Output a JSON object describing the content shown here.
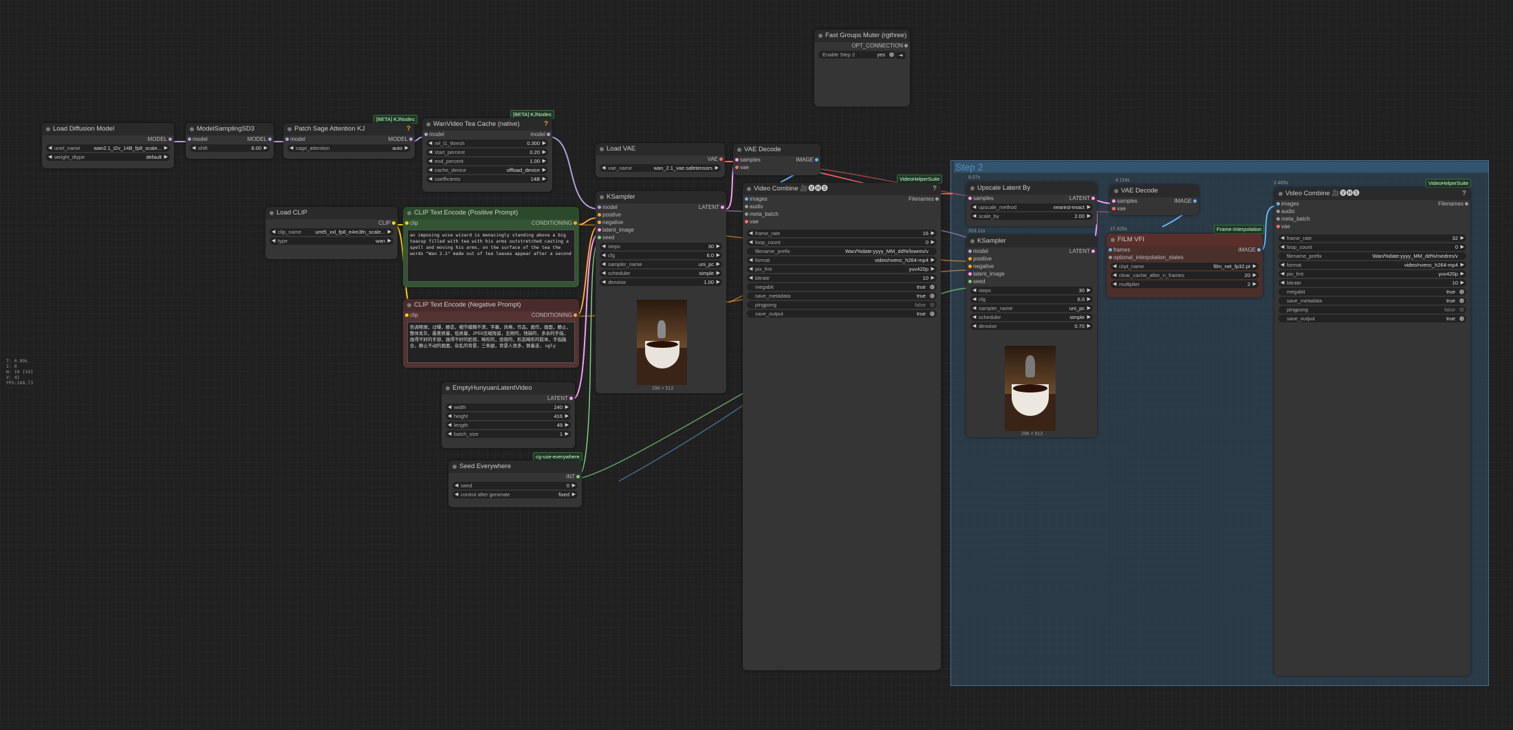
{
  "stats": [
    "T: 0.89s",
    "I: 0",
    "N: 19 [19]",
    "V: 41",
    "FPS:168.73"
  ],
  "group": {
    "title": "Step 2"
  },
  "badges": {
    "kj1": "[BETA] KJNodes",
    "kj2": "[BETA] KJNodes",
    "vhs1": "VideoHelperSuite",
    "vhs2": "VideoHelperSuite",
    "cg": "cg-use-everywhere",
    "fi": "Frame-Interpolation"
  },
  "timings": {
    "t1": "8.07s",
    "t2": "203.11s",
    "t3": "4.114s",
    "t4": "27.425s",
    "t5": "2.469s"
  },
  "load_diffusion": {
    "title": "Load Diffusion Model",
    "out": "MODEL",
    "w": [
      {
        "n": "unet_name",
        "v": "wan2.1_t2v_14B_fp8_scale..."
      },
      {
        "n": "weight_dtype",
        "v": "default"
      }
    ]
  },
  "model_sampling": {
    "title": "ModelSamplingSD3",
    "in": "model",
    "out": "MODEL",
    "w": [
      {
        "n": "shift",
        "v": "8.00"
      }
    ]
  },
  "patch_sage": {
    "title": "Patch Sage Attention KJ",
    "in": "model",
    "out": "MODEL",
    "w": [
      {
        "n": "sage_attention",
        "v": "auto"
      }
    ]
  },
  "teacache": {
    "title": "WanVideo Tea Cache (native)",
    "in": "model",
    "out": "model",
    "w": [
      {
        "n": "rel_l1_thresh",
        "v": "0.300"
      },
      {
        "n": "start_percent",
        "v": "0.20"
      },
      {
        "n": "end_percent",
        "v": "1.00"
      },
      {
        "n": "cache_device",
        "v": "offload_device"
      },
      {
        "n": "coefficients",
        "v": "14B"
      }
    ]
  },
  "load_vae": {
    "title": "Load VAE",
    "out": "VAE",
    "w": [
      {
        "n": "vae_name",
        "v": "wan_2.1_vae.safetensors"
      }
    ]
  },
  "vae_decode1": {
    "title": "VAE Decode",
    "in1": "samples",
    "in2": "vae",
    "out": "IMAGE"
  },
  "fast_groups": {
    "title": "Fast Groups Muter (rgthree)",
    "out": "OPT_CONNECTION",
    "toggle_label": "Enable Step 2",
    "toggle_value": "yes"
  },
  "load_clip": {
    "title": "Load CLIP",
    "out": "CLIP",
    "w": [
      {
        "n": "clip_name",
        "v": "umt5_xxl_fp8_e4m3fn_scale..."
      },
      {
        "n": "type",
        "v": "wan"
      }
    ]
  },
  "clip_pos": {
    "title": "CLIP Text Encode (Positive Prompt)",
    "in": "clip",
    "out": "CONDITIONING",
    "text": "an imposing wise wizard is menacingly standing above a big teacup filled with tea with his arms outstretched casting a spell and moving his arms, on the surface of the tea the words \"Wan 2.1\" made out of tea leaves appear after a second"
  },
  "clip_neg": {
    "title": "CLIP Text Encode (Negative Prompt)",
    "in": "clip",
    "out": "CONDITIONING",
    "text": "色调艳丽，过曝，静态，细节模糊不清，字幕，风格，作品，画作，画面，静止，整体发灰，最差质量，低质量，JPEG压缩残留，丑陋的，残缺的，多余的手指，画得不好的手部，画得不好的脸部，畸形的，毁容的，形态畸形的肢体，手指融合，静止不动的画面，杂乱的背景，三条腿，背景人很多，倒着走, ugly"
  },
  "ksampler1": {
    "title": "KSampler",
    "out": "LATENT",
    "ins": [
      "model",
      "positive",
      "negative",
      "latent_image",
      "seed"
    ],
    "w": [
      {
        "n": "steps",
        "v": "30"
      },
      {
        "n": "cfg",
        "v": "6.0"
      },
      {
        "n": "sampler_name",
        "v": "uni_pc"
      },
      {
        "n": "scheduler",
        "v": "simple"
      },
      {
        "n": "denoise",
        "v": "1.00"
      }
    ],
    "img_size": "296 × 512"
  },
  "empty_latent": {
    "title": "EmptyHunyuanLatentVideo",
    "out": "LATENT",
    "w": [
      {
        "n": "width",
        "v": "240"
      },
      {
        "n": "height",
        "v": "416"
      },
      {
        "n": "length",
        "v": "49"
      },
      {
        "n": "batch_size",
        "v": "1"
      }
    ]
  },
  "seed_ev": {
    "title": "Seed Everywhere",
    "out": "INT",
    "w": [
      {
        "n": "seed",
        "v": "0"
      },
      {
        "n": "control after generate",
        "v": "fixed"
      }
    ]
  },
  "video_combine1": {
    "title": "Video Combine 🎥🅥🅗🅢",
    "out": "Filenames",
    "ins": [
      "images",
      "audio",
      "meta_batch",
      "vae"
    ],
    "w": [
      {
        "n": "frame_rate",
        "v": "16"
      },
      {
        "n": "loop_count",
        "v": "0"
      },
      {
        "n": "filename_prefix",
        "v": "Wan/%date:yyyy_MM_dd%/lowres/v"
      },
      {
        "n": "format",
        "v": "video/nvenc_h264-mp4"
      },
      {
        "n": "pix_fmt",
        "v": "yuv420p"
      },
      {
        "n": "bitrate",
        "v": "10"
      }
    ],
    "toggles": [
      {
        "n": "megabit",
        "v": "true"
      },
      {
        "n": "save_metadata",
        "v": "true"
      },
      {
        "n": "pingpong",
        "v": "false"
      },
      {
        "n": "save_output",
        "v": "true"
      }
    ]
  },
  "upscale_latent": {
    "title": "Upscale Latent By",
    "in": "samples",
    "out": "LATENT",
    "w": [
      {
        "n": "upscale_method",
        "v": "nearest-exact"
      },
      {
        "n": "scale_by",
        "v": "2.00"
      }
    ]
  },
  "ksampler2": {
    "title": "KSampler",
    "out": "LATENT",
    "ins": [
      "model",
      "positive",
      "negative",
      "latent_image",
      "seed"
    ],
    "w": [
      {
        "n": "steps",
        "v": "30"
      },
      {
        "n": "cfg",
        "v": "6.0"
      },
      {
        "n": "sampler_name",
        "v": "uni_pc"
      },
      {
        "n": "scheduler",
        "v": "simple"
      },
      {
        "n": "denoise",
        "v": "0.70"
      }
    ],
    "img_size": "296 × 512"
  },
  "vae_decode2": {
    "title": "VAE Decode",
    "in1": "samples",
    "in2": "vae",
    "out": "IMAGE"
  },
  "film_vfi": {
    "title": "FILM VFI",
    "ins": [
      "frames",
      "optional_interpolation_states"
    ],
    "out": "IMAGE",
    "w": [
      {
        "n": "ckpt_name",
        "v": "film_net_fp32.pt"
      },
      {
        "n": "clear_cache_after_n_frames",
        "v": "20"
      },
      {
        "n": "multiplier",
        "v": "2"
      }
    ]
  },
  "video_combine2": {
    "title": "Video Combine 🎥🅥🅗🅢",
    "out": "Filenames",
    "ins": [
      "images",
      "audio",
      "meta_batch",
      "vae"
    ],
    "w": [
      {
        "n": "frame_rate",
        "v": "32"
      },
      {
        "n": "loop_count",
        "v": "0"
      },
      {
        "n": "filename_prefix",
        "v": "Wan/%date:yyyy_MM_dd%/medres/v"
      },
      {
        "n": "format",
        "v": "video/nvenc_h264-mp4"
      },
      {
        "n": "pix_fmt",
        "v": "yuv420p"
      },
      {
        "n": "bitrate",
        "v": "10"
      }
    ],
    "toggles": [
      {
        "n": "megabit",
        "v": "true"
      },
      {
        "n": "save_metadata",
        "v": "true"
      },
      {
        "n": "pingpong",
        "v": "false"
      },
      {
        "n": "save_output",
        "v": "true"
      }
    ]
  },
  "colors": {
    "model": "#b39ddb",
    "clip": "#ffd500",
    "conditioning": "#ffa931",
    "latent": "#ff9cf9",
    "vae": "#ff6e6e",
    "image": "#64b5f6",
    "int": "#7fd17f"
  }
}
